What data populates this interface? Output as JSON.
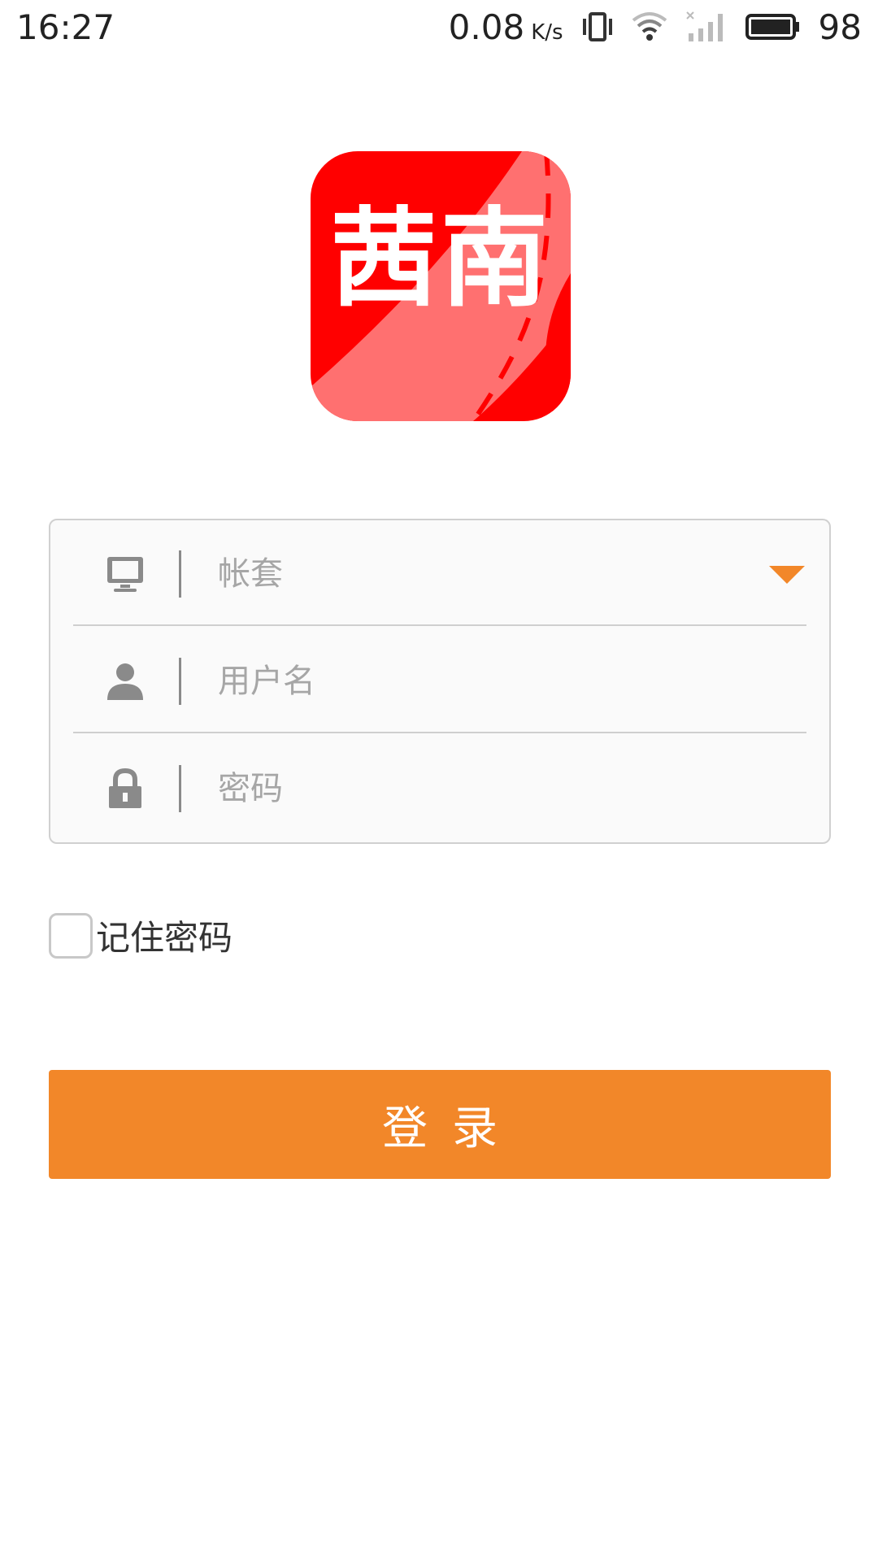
{
  "status_bar": {
    "time": "16:27",
    "net_speed": "0.08",
    "net_speed_unit": "K/s",
    "battery_level": "98",
    "icons": [
      "vibrate-icon",
      "wifi-icon",
      "signal-icon",
      "battery-icon"
    ]
  },
  "logo": {
    "text": "茜南",
    "brand_color": "#ff0000"
  },
  "form": {
    "account_placeholder": "帐套",
    "username_placeholder": "用户名",
    "password_placeholder": "密码",
    "icons": [
      "monitor-icon",
      "user-icon",
      "lock-icon",
      "dropdown-arrow-icon"
    ]
  },
  "remember": {
    "label": "记住密码",
    "checked": false
  },
  "login_button": {
    "label": "登录",
    "color": "#f28729"
  }
}
